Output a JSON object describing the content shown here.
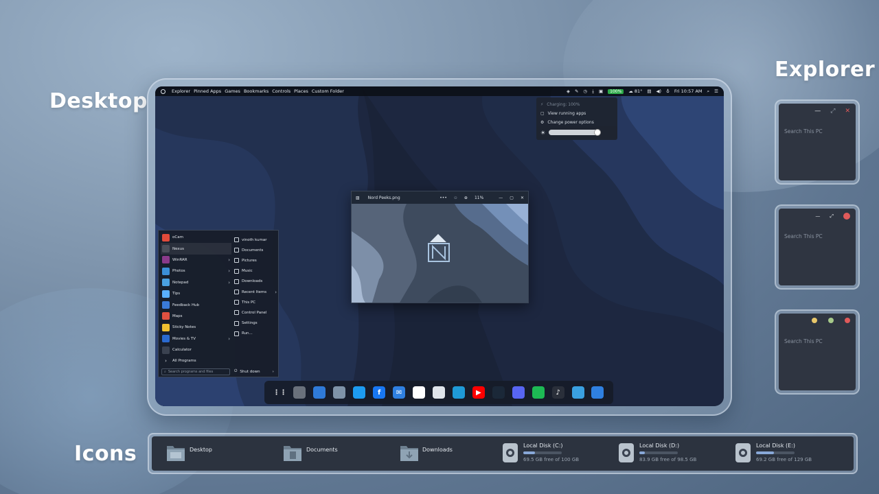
{
  "sections": {
    "desktop": "Desktop",
    "explorer": "Explorer",
    "icons": "Icons"
  },
  "topbar": {
    "menu": [
      "Explorer",
      "Pinned Apps",
      "Games",
      "Bookmarks",
      "Controls",
      "Places",
      "Custom Folder"
    ],
    "battery": "100%",
    "weather": "81°",
    "clock": "Fri 10:57 AM"
  },
  "power_popup": {
    "charging": "Charging: 100%",
    "view_apps": "View running apps",
    "power_options": "Change power options",
    "brightness_level": 0.92
  },
  "viewer": {
    "filename": "Nord Peeks.png",
    "zoom": "11%"
  },
  "start_menu": {
    "apps": [
      {
        "label": "oCam",
        "color": "#e04a3a",
        "chevron": false
      },
      {
        "label": "Nexus",
        "color": "#4a4f5a",
        "chevron": false
      },
      {
        "label": "WinRAR",
        "color": "#8a3a8a",
        "chevron": true
      },
      {
        "label": "Photos",
        "color": "#3b8fd8",
        "chevron": true
      },
      {
        "label": "Notepad",
        "color": "#4aa0e0",
        "chevron": true
      },
      {
        "label": "Tips",
        "color": "#5ab0ff",
        "chevron": false
      },
      {
        "label": "Feedback Hub",
        "color": "#3a7ad8",
        "chevron": false
      },
      {
        "label": "Maps",
        "color": "#e05040",
        "chevron": false
      },
      {
        "label": "Sticky Notes",
        "color": "#f0c030",
        "chevron": false
      },
      {
        "label": "Movies & TV",
        "color": "#2a6ad0",
        "chevron": true
      },
      {
        "label": "Calculator",
        "color": "#3a4250",
        "chevron": false
      }
    ],
    "all_programs": "All Programs",
    "places": [
      {
        "label": "vinoth kumar",
        "chevron": false
      },
      {
        "label": "Documents",
        "chevron": false
      },
      {
        "label": "Pictures",
        "chevron": false
      },
      {
        "label": "Music",
        "chevron": false
      },
      {
        "label": "Downloads",
        "chevron": false
      },
      {
        "label": "Recent Items",
        "chevron": true
      },
      {
        "label": "This PC",
        "chevron": false
      },
      {
        "label": "Control Panel",
        "chevron": false
      },
      {
        "label": "Settings",
        "chevron": false
      },
      {
        "label": "Run...",
        "chevron": false
      }
    ],
    "search_placeholder": "Search programs and files",
    "shutdown": "Shut down"
  },
  "dock": [
    {
      "name": "apps-grid-icon",
      "color": "transparent",
      "glyph": "⋮⋮"
    },
    {
      "name": "recycle-bin-icon",
      "color": "#6a717c",
      "glyph": ""
    },
    {
      "name": "vscode-icon",
      "color": "#2f7ad8",
      "glyph": ""
    },
    {
      "name": "file-explorer-icon",
      "color": "#7f93a8",
      "glyph": ""
    },
    {
      "name": "twitter-icon",
      "color": "#1d9bf0",
      "glyph": ""
    },
    {
      "name": "facebook-icon",
      "color": "#1877f2",
      "glyph": "f"
    },
    {
      "name": "mail-icon",
      "color": "#2f80e0",
      "glyph": "✉"
    },
    {
      "name": "photos-icon",
      "color": "#ffffff",
      "glyph": ""
    },
    {
      "name": "chrome-icon",
      "color": "#dfe4ea",
      "glyph": ""
    },
    {
      "name": "edge-icon",
      "color": "#1f9ad6",
      "glyph": ""
    },
    {
      "name": "youtube-icon",
      "color": "#ff0000",
      "glyph": "▶"
    },
    {
      "name": "steam-icon",
      "color": "#1b2838",
      "glyph": ""
    },
    {
      "name": "discord-icon",
      "color": "#5865f2",
      "glyph": ""
    },
    {
      "name": "spotify-icon",
      "color": "#1db954",
      "glyph": ""
    },
    {
      "name": "music-icon",
      "color": "#2a2f3a",
      "glyph": "♪"
    },
    {
      "name": "media-player-icon",
      "color": "#3aa0e0",
      "glyph": ""
    },
    {
      "name": "more-apps-icon",
      "color": "#2f80e0",
      "glyph": ""
    }
  ],
  "explorer_windows": [
    {
      "search": "Search This PC",
      "style": "windows"
    },
    {
      "search": "Search This PC",
      "style": "mono"
    },
    {
      "search": "Search This PC",
      "style": "mac"
    }
  ],
  "icons_bar": {
    "folders": [
      "Desktop",
      "Documents",
      "Downloads"
    ],
    "disks": [
      {
        "label": "Local Disk (C:)",
        "free": "69.5 GB free of 100 GB",
        "used_fraction": 0.31
      },
      {
        "label": "Local Disk (D:)",
        "free": "83.9 GB free of 98.5 GB",
        "used_fraction": 0.15
      },
      {
        "label": "Local Disk (E:)",
        "free": "69.2 GB free of 129 GB",
        "used_fraction": 0.46
      }
    ]
  },
  "colors": {
    "accent": "#88a8d8",
    "battery": "#2eaa4a",
    "close_red": "#e05a5a",
    "mac_yellow": "#e8c76a",
    "mac_green": "#a6c98a"
  }
}
